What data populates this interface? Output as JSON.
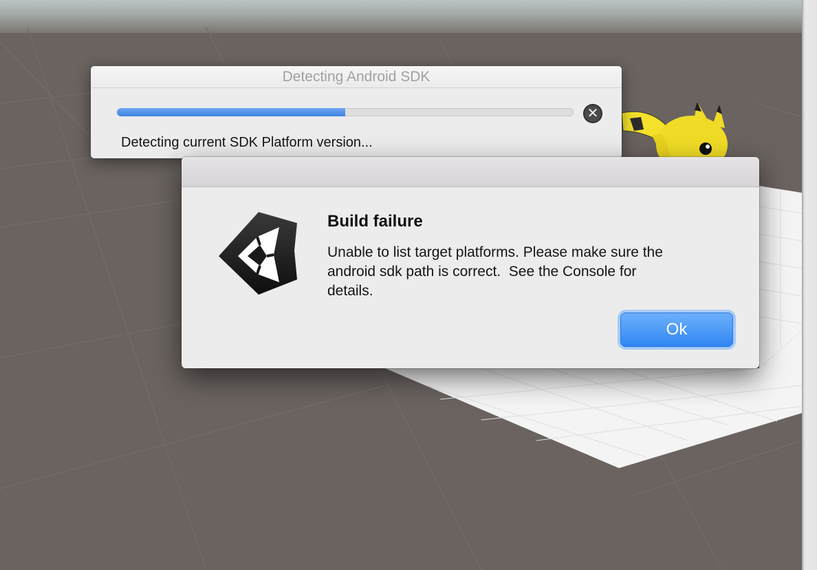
{
  "colors": {
    "accent": "#3f82e2",
    "ok_button": "#2f86f3",
    "dialog_bg": "#ececec",
    "editor_bg": "#6a6360"
  },
  "progress_window": {
    "title": "Detecting Android SDK",
    "progress_fraction": 0.5,
    "status_text": "Detecting current SDK Platform version...",
    "cancel_icon": "close-circle-icon"
  },
  "alert": {
    "icon": "unity-logo-icon",
    "title": "Build failure",
    "message": "Unable to list target platforms. Please make sure the\nandroid sdk path is correct.  See the Console for\ndetails.",
    "ok_label": "Ok"
  },
  "scene": {
    "character_icon": "pikachu-figure-icon"
  }
}
